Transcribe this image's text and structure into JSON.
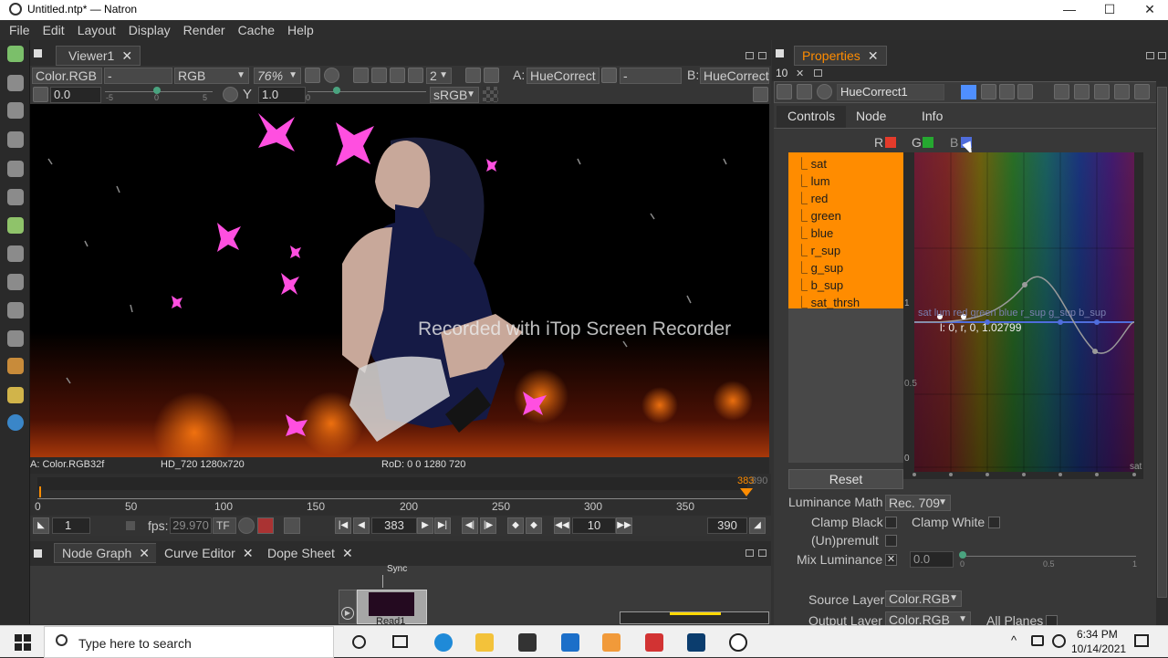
{
  "window": {
    "title": "Untitled.ntp* — Natron",
    "minimize": "—",
    "maximize": "☐",
    "close": "✕"
  },
  "menu": [
    "File",
    "Edit",
    "Layout",
    "Display",
    "Render",
    "Cache",
    "Help"
  ],
  "viewer": {
    "tab": "Viewer1",
    "layer": "Color.RGB",
    "alpha": "-",
    "channels": "RGB",
    "zoom": "76%",
    "input_count": "2",
    "input_a_label": "A:",
    "input_a": "HueCorrect",
    "input_a_op": "-",
    "input_b_label": "B:",
    "input_b": "HueCorrect",
    "gain": "0.0",
    "gamma_label": "Y",
    "gamma": "1.0",
    "gain_ticks": [
      "-5",
      "0",
      "5"
    ],
    "gamma_ticks": [
      "0"
    ],
    "colorspace": "sRGB",
    "info_left": "A: Color.RGB32f",
    "info_format": "HD_720 1280x720",
    "info_rod": "RoD: 0 0 1280 720",
    "watermark": "Recorded with iTop Screen Recorder"
  },
  "timeline": {
    "ticks": [
      "0",
      "50",
      "100",
      "150",
      "200",
      "250",
      "300",
      "350"
    ],
    "end_marker": "383",
    "end_marker_b": "390",
    "start_frame": "1",
    "fps_label": "fps:",
    "fps": "29.970",
    "mode": "TF",
    "current_frame": "383",
    "increment": "10",
    "end_frame": "390"
  },
  "bottom_tabs": [
    "Node Graph",
    "Curve Editor",
    "Dope Sheet"
  ],
  "node_graph": {
    "node_label": "Read1",
    "sync_label": "Sync"
  },
  "properties": {
    "tab": "Properties",
    "max_panels": "10",
    "node_name": "HueCorrect1",
    "tabs": [
      "Controls",
      "Node",
      "Info"
    ],
    "channels": [
      {
        "label": "R",
        "color": "#e53b2b"
      },
      {
        "label": "G",
        "color": "#25a830"
      },
      {
        "label": "B",
        "color": "#4f6ddc"
      }
    ],
    "curves": [
      "sat",
      "lum",
      "red",
      "green",
      "blue",
      "r_sup",
      "g_sup",
      "b_sup",
      "sat_thrsh"
    ],
    "graph_readout": "l: 0, r, 0, 1.02799",
    "graph_axis": [
      "1",
      "0.5",
      "0"
    ],
    "graph_overlay": "sat  lum  red  green  blue  r_sup  g_sup  b_sup",
    "graph_corner": "sat",
    "reset": "Reset",
    "luminance_math_label": "Luminance Math",
    "luminance_math": "Rec. 709",
    "clamp_black": "Clamp Black",
    "clamp_white": "Clamp White",
    "unpremult": "(Un)premult",
    "mix_luminance": "Mix Luminance",
    "mix_value": "0.0",
    "mix_ticks": [
      "0",
      "0.5",
      "1"
    ],
    "source_layer_label": "Source Layer",
    "source_layer": "Color.RGB",
    "output_layer_label": "Output Layer",
    "output_layer": "Color.RGB",
    "all_planes": "All Planes"
  },
  "taskbar": {
    "search_placeholder": "Type here to search",
    "time": "6:34 PM",
    "date": "10/14/2021"
  },
  "colors": {
    "accent": "#ff8c00",
    "panel": "#383838",
    "dark": "#2c2c2c"
  }
}
